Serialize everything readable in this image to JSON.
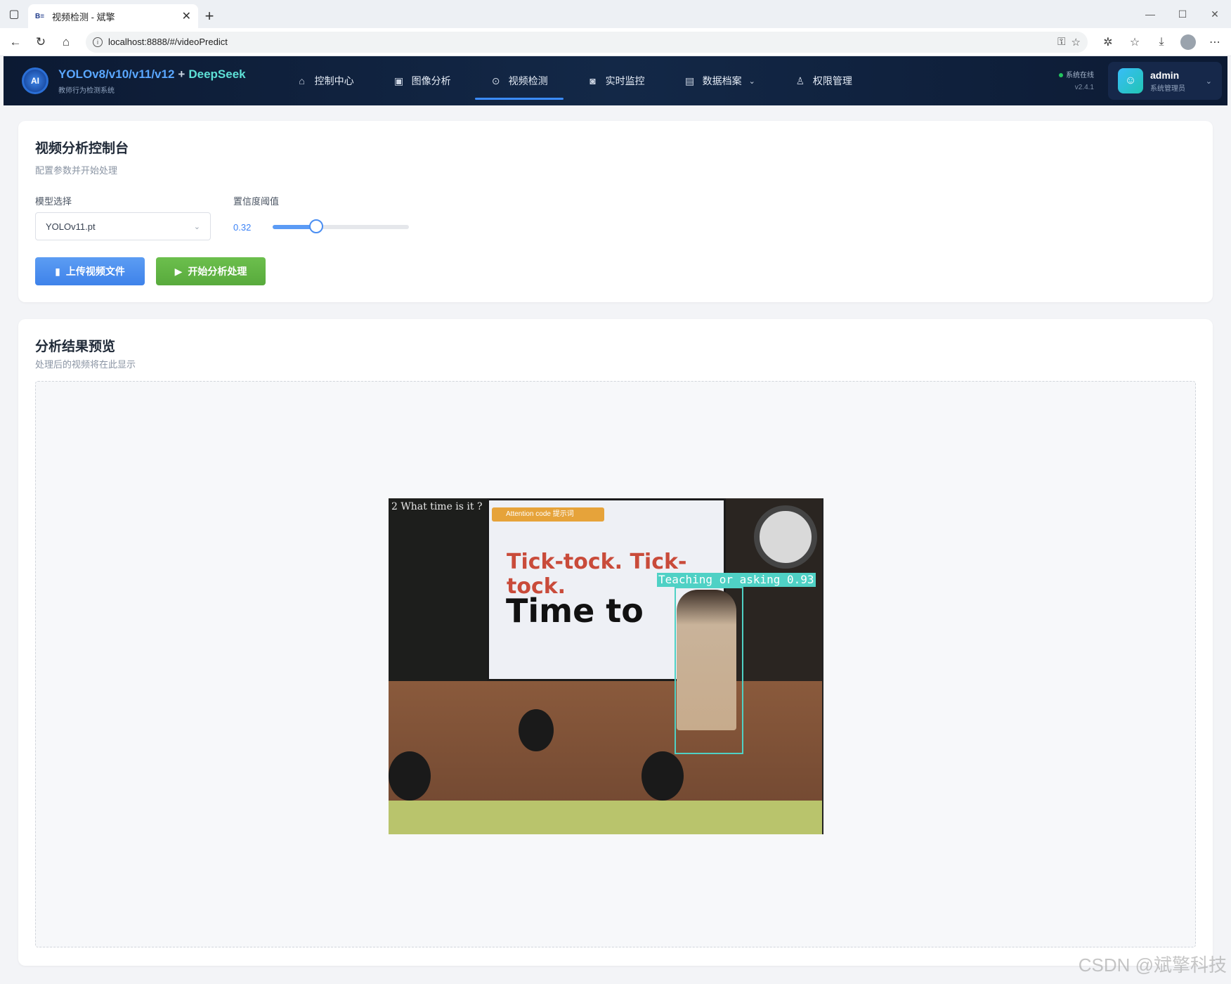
{
  "browser": {
    "tab_title": "视频检测 - 斌擎",
    "tab_favicon": "B≡",
    "url": "localhost:8888/#/videoPredict"
  },
  "header": {
    "brand_part1": "YOLOv8/v10/v11/v12",
    "brand_plus": "+",
    "brand_part2": "DeepSeek",
    "subtitle": "教师行为检测系统",
    "logo_text": "AI",
    "nav": [
      {
        "label": "控制中心",
        "icon": "home-icon"
      },
      {
        "label": "图像分析",
        "icon": "image-icon"
      },
      {
        "label": "视频检测",
        "icon": "play-circle-icon"
      },
      {
        "label": "实时监控",
        "icon": "camera-icon"
      },
      {
        "label": "数据档案",
        "icon": "document-icon"
      },
      {
        "label": "权限管理",
        "icon": "user-icon"
      }
    ],
    "active_nav": "视频检测",
    "status_text": "系统在线",
    "version": "v2.4.1",
    "user_name": "admin",
    "user_role": "系统管理员"
  },
  "control": {
    "title": "视频分析控制台",
    "subtitle": "配置参数并开始处理",
    "model_label": "模型选择",
    "model_value": "YOLOv11.pt",
    "conf_label": "置信度阈值",
    "conf_value": "0.32",
    "conf_fraction": 0.32,
    "upload_label": "上传视频文件",
    "start_label": "开始分析处理"
  },
  "result": {
    "title": "分析结果预览",
    "subtitle": "处理后的视频将在此显示",
    "detection_label": "Teaching or asking 0.93",
    "chalk_text": "2 What time is it ?",
    "attention_text": "Attention code 提示词",
    "board_text1": "Tick-tock. Tick-tock.",
    "board_text2": "Time to"
  },
  "watermark": "CSDN @斌擎科技",
  "colors": {
    "accent": "#3b82f6",
    "success": "#58aa3c",
    "header_bg": "#0c1a33",
    "bbox": "#4fd1c5"
  }
}
